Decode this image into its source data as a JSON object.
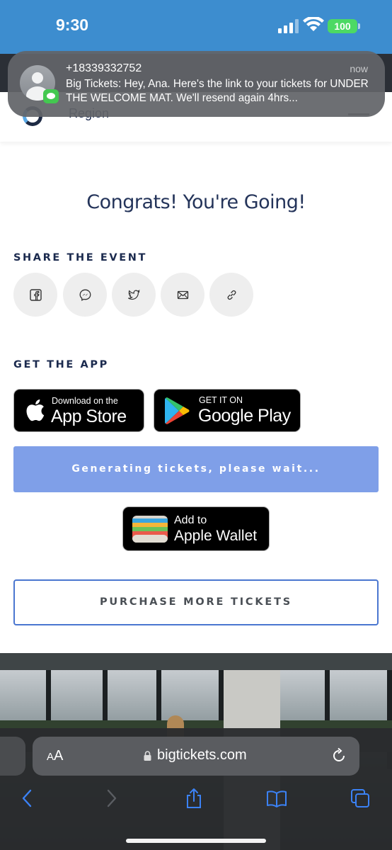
{
  "status_bar": {
    "time": "9:30",
    "battery": "100"
  },
  "site_header": {
    "region_label": "Region"
  },
  "notification": {
    "sender": "+18339332752",
    "time": "now",
    "body": "Big Tickets: Hey, Ana. Here's the link to your tickets for UNDER THE WELCOME MAT. We'll resend again 4hrs..."
  },
  "main": {
    "heading": "Congrats! You're Going!",
    "share_title": "SHARE THE EVENT",
    "share_buttons": [
      "facebook-icon",
      "messenger-icon",
      "twitter-icon",
      "email-icon",
      "link-icon"
    ],
    "app_title": "GET THE APP",
    "app_store": {
      "small": "Download on the",
      "big": "App Store"
    },
    "google_play": {
      "small": "GET IT ON",
      "big": "Google Play"
    },
    "generating_label": "Generating tickets, please wait...",
    "wallet": {
      "small": "Add to",
      "big": "Apple Wallet"
    },
    "purchase_label": "PURCHASE MORE TICKETS"
  },
  "browser": {
    "aa_label": "AA",
    "url": "bigtickets.com"
  },
  "colors": {
    "status_bar": "#3d8dcf",
    "generating_button": "#7f9fe8",
    "purchase_border": "#4a76d0",
    "heading": "#24345a"
  }
}
